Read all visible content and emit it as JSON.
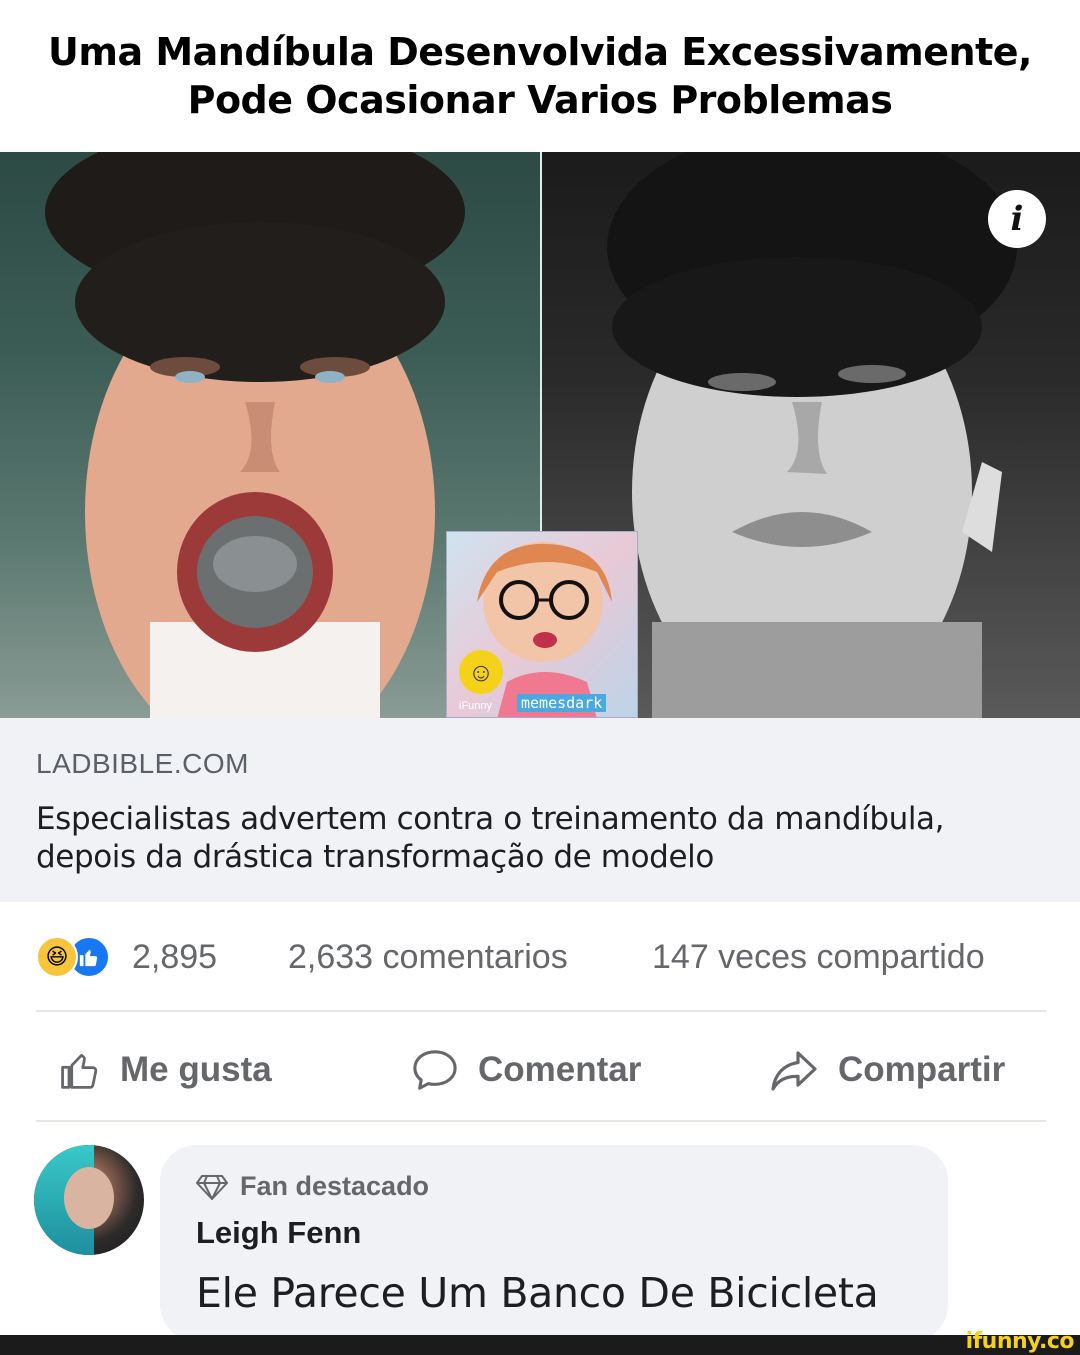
{
  "caption": {
    "line1": "Uma Mandíbula Desenvolvida Excessivamente,",
    "line2": "Pode Ocasionar Varios Problemas"
  },
  "image": {
    "info_icon": "info-icon",
    "watermark": {
      "source_small": "iFunny",
      "tag": "memesdark"
    }
  },
  "link_preview": {
    "domain": "LADBIBLE.COM",
    "title_line1": "Especialistas advertem contra o treinamento da mandíbula,",
    "title_line2": "depois da drástica transformação de modelo"
  },
  "stats": {
    "reactions_count": "2,895",
    "comments": "2,633 comentarios",
    "shares": "147 veces compartido",
    "reaction_icons": [
      "laugh-reaction-icon",
      "like-reaction-icon"
    ]
  },
  "actions": {
    "like_label": "Me gusta",
    "comment_label": "Comentar",
    "share_label": "Compartir"
  },
  "comment": {
    "badge": "Fan destacado",
    "author": "Leigh Fenn",
    "text": "Ele Parece Um Banco De Bicicleta"
  },
  "footer": {
    "logo": "ifunny.co"
  },
  "colors": {
    "facebook_blue": "#1877f2",
    "laugh_yellow": "#f7c53c",
    "card_gray": "#f0f2f5",
    "muted_text": "#65676b",
    "ifunny_yellow": "#f5d21a"
  }
}
